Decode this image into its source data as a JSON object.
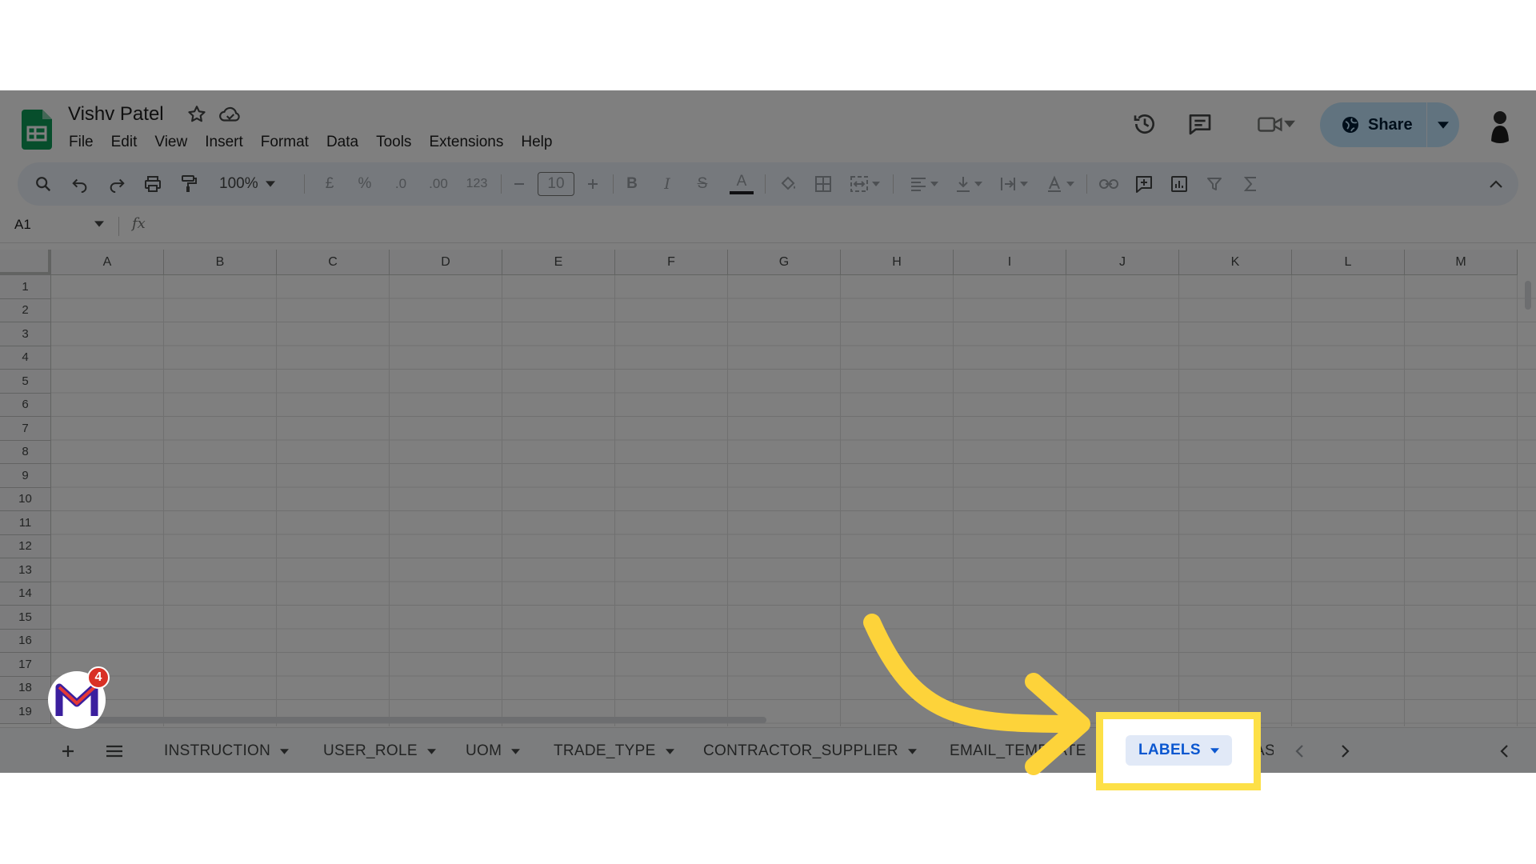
{
  "document": {
    "title": "Vishv Patel",
    "menu": [
      "File",
      "Edit",
      "View",
      "Insert",
      "Format",
      "Data",
      "Tools",
      "Extensions",
      "Help"
    ]
  },
  "header": {
    "share_label": "Share"
  },
  "toolbar": {
    "zoom": "100%",
    "currency": "£",
    "percent": "%",
    "decimal_decrease": ".0",
    "decimal_increase": ".00",
    "number_format": "123",
    "font_size": "10",
    "bold": "B",
    "italic": "I",
    "strike": "S",
    "text_color": "A"
  },
  "formula_bar": {
    "cell_ref": "A1",
    "fx": "fx"
  },
  "grid": {
    "columns": [
      "A",
      "B",
      "C",
      "D",
      "E",
      "F",
      "G",
      "H",
      "I",
      "J",
      "K",
      "L",
      "M"
    ],
    "rows": [
      "1",
      "2",
      "3",
      "4",
      "5",
      "6",
      "7",
      "8",
      "9",
      "10",
      "11",
      "12",
      "13",
      "14",
      "15",
      "16",
      "17",
      "18",
      "19"
    ]
  },
  "sheet_tabs": {
    "tabs": [
      "INSTRUCTION",
      "USER_ROLE",
      "UOM",
      "TRADE_TYPE",
      "CONTRACTOR_SUPPLIER",
      "EMAIL_TEMPLATE",
      "LABELS",
      "AS"
    ],
    "active": "LABELS"
  },
  "widget": {
    "badge_count": "4"
  },
  "colors": {
    "highlight": "#fde047",
    "active_tab_text": "#0b57d0",
    "share_bg": "#c2e7ff",
    "sheets_green": "#0f9d58"
  }
}
